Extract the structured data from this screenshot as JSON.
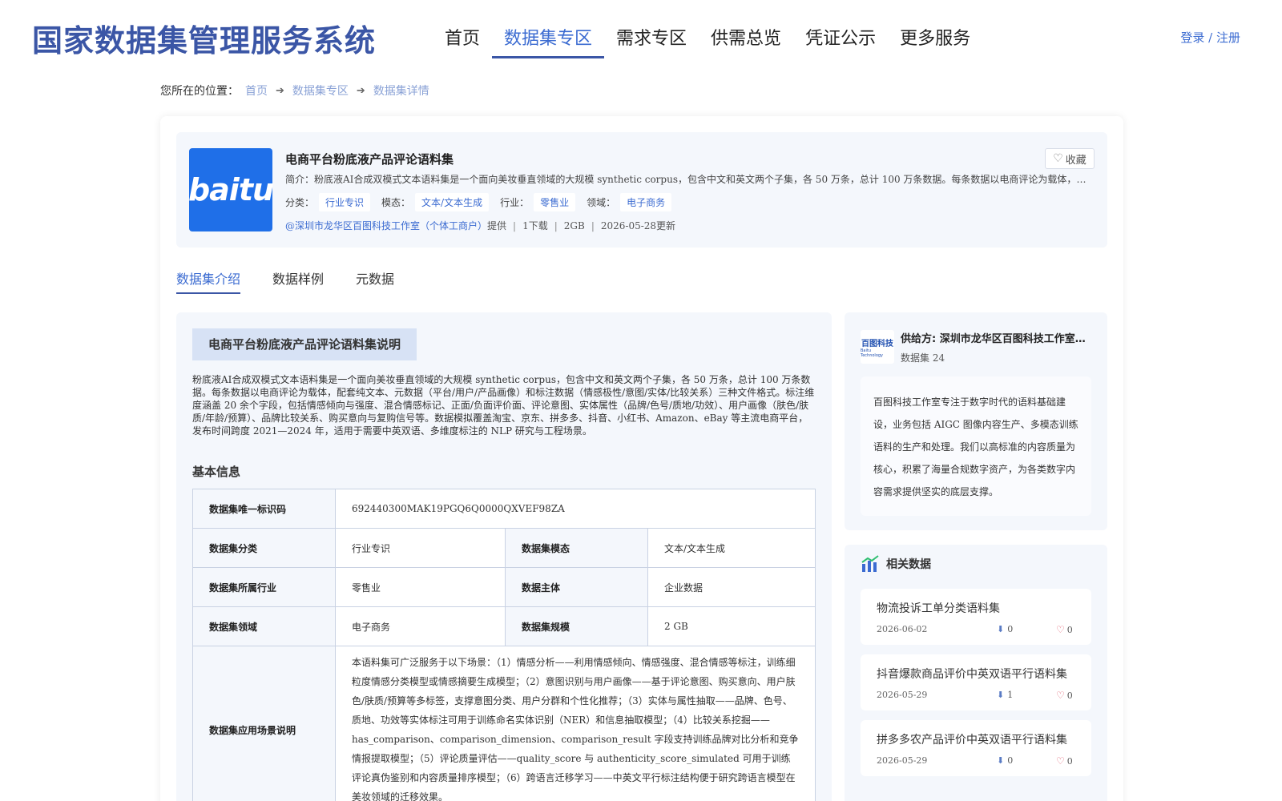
{
  "header": {
    "site_title": "国家数据集管理服务系统",
    "nav": [
      "首页",
      "数据集专区",
      "需求专区",
      "供需总览",
      "凭证公示",
      "更多服务"
    ],
    "active_nav": 1,
    "login": "登录 / 注册"
  },
  "breadcrumb": {
    "prefix": "您所在的位置：",
    "items": [
      "首页",
      "数据集专区",
      "数据集详情"
    ]
  },
  "dataset": {
    "logo_text": "baitu",
    "title": "电商平台粉底液产品评论语料集",
    "intro": "简介：粉底液AI合成双模式文本语料集是一个面向美妆垂直领域的大规模 synthetic corpus，包含中文和英文两个子集，各 50 万条，总计 100 万条数据。每条数据以电商评论为载体，配套纯文本、元数据（平台/用户/产品画像）和标注数据（情感极性/意图/实体/比较关系）三种文件格式。",
    "tags": [
      {
        "label": "分类：",
        "value": "行业专识"
      },
      {
        "label": "模态：",
        "value": "文本/文本生成"
      },
      {
        "label": "行业：",
        "value": "零售业"
      },
      {
        "label": "领域：",
        "value": "电子商务"
      }
    ],
    "provider": "@深圳市龙华区百图科技工作室（个体工商户）",
    "provided": "提供",
    "downloads": "1下载",
    "size": "2GB",
    "updated": "2026-05-28更新",
    "fav_label": "收藏"
  },
  "tabs": [
    "数据集介绍",
    "数据样例",
    "元数据"
  ],
  "active_tab": 0,
  "description": {
    "title": "电商平台粉底液产品评论语料集说明",
    "text": "粉底液AI合成双模式文本语料集是一个面向美妆垂直领域的大规模 synthetic corpus，包含中文和英文两个子集，各 50 万条，总计 100 万条数据。每条数据以电商评论为载体，配套纯文本、元数据（平台/用户/产品画像）和标注数据（情感极性/意图/实体/比较关系）三种文件格式。标注维度涵盖 20 余个字段，包括情感倾向与强度、混合情感标记、正面/负面评价面、评论意图、实体属性（品牌/色号/质地/功效）、用户画像（肤色/肤质/年龄/预算）、品牌比较关系、购买意向与复购信号等。数据模拟覆盖淘宝、京东、拼多多、抖音、小红书、Amazon、eBay 等主流电商平台，发布时间跨度 2021—2024 年，适用于需要中英双语、多维度标注的 NLP 研究与工程场景。"
  },
  "basic_info": {
    "title": "基本信息",
    "uid_label": "数据集唯一标识码",
    "uid_value": "692440300MAK19PGQ6Q0000QXVEF98ZA",
    "category_label": "数据集分类",
    "category_value": "行业专识",
    "modality_label": "数据集模态",
    "modality_value": "文本/文本生成",
    "industry_label": "数据集所属行业",
    "industry_value": "零售业",
    "subject_label": "数据主体",
    "subject_value": "企业数据",
    "domain_label": "数据集领域",
    "domain_value": "电子商务",
    "scale_label": "数据集规模",
    "scale_value": "2 GB",
    "usage_label": "数据集应用场景说明",
    "usage_value": "本语料集可广泛服务于以下场景：（1）情感分析——利用情感倾向、情感强度、混合情感等标注，训练细粒度情感分类模型或情感摘要生成模型；（2）意图识别与用户画像——基于评论意图、购买意向、用户肤色/肤质/预算等多标签，支撑意图分类、用户分群和个性化推荐；（3）实体与属性抽取——品牌、色号、质地、功效等实体标注可用于训练命名实体识别（NER）和信息抽取模型；（4）比较关系挖掘——has_comparison、comparison_dimension、comparison_result 字段支持训练品牌对比分析和竞争情报提取模型；（5）评论质量评估——quality_score 与 authenticity_score_simulated 可用于训练评论真伪鉴别和内容质量排序模型；（6）跨语言迁移学习——中英文平行标注结构便于研究跨语言模型在美妆领域的迁移效果。"
  },
  "provider_panel": {
    "logo_line1": "百图科技",
    "logo_line2": "Baitu Technology",
    "name": "供给方: 深圳市龙华区百图科技工作室（个体工商户）",
    "count": "数据集 24",
    "desc": "百图科技工作室专注于数字时代的语料基础建设，业务包括 AIGC 图像内容生产、多模态训练语料的生产和处理。我们以高标准的内容质量为核心，积累了海量合规数字资产，为各类数字内容需求提供坚实的底层支撑。"
  },
  "related": {
    "title": "相关数据",
    "items": [
      {
        "name": "物流投诉工单分类语料集",
        "date": "2026-06-02",
        "downloads": "0",
        "favs": "0"
      },
      {
        "name": "抖音爆款商品评价中英双语平行语料集",
        "date": "2026-05-29",
        "downloads": "1",
        "favs": "0"
      },
      {
        "name": "拼多多农产品评价中英双语平行语料集",
        "date": "2026-05-29",
        "downloads": "0",
        "favs": "0"
      }
    ]
  },
  "colors": {
    "brand": "#3b56a6",
    "link": "#3b6bd1",
    "panel_bg": "#f4f7fc",
    "logo_bg": "#1f6fe8"
  }
}
